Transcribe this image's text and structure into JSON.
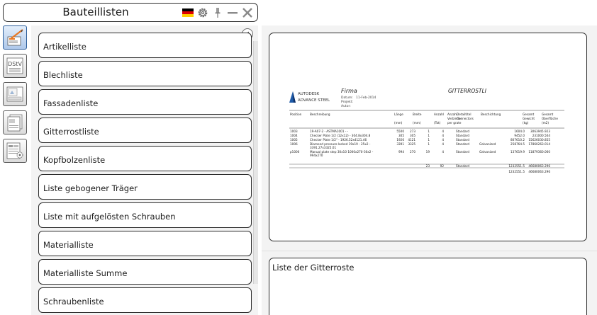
{
  "window": {
    "title": "Bauteillisten"
  },
  "toolbar": {
    "icons": [
      "german-flag-icon",
      "settings-gear-icon",
      "pin-icon",
      "minimize-icon",
      "close-icon"
    ]
  },
  "sidebar": {
    "buttons": [
      {
        "name": "report-lists-icon",
        "active": true
      },
      {
        "name": "dstv-icon",
        "label": "DStV",
        "active": false
      },
      {
        "name": "drawing-sheet-icon",
        "active": false
      },
      {
        "name": "document-stack-icon",
        "active": false
      },
      {
        "name": "table-settings-icon",
        "active": false
      }
    ]
  },
  "lists": {
    "items": [
      {
        "label": "Artikelliste"
      },
      {
        "label": "Blechliste"
      },
      {
        "label": "Fassadenliste"
      },
      {
        "label": "Gitterrostliste"
      },
      {
        "label": "Kopfbolzenliste"
      },
      {
        "label": "Liste gebogener Träger"
      },
      {
        "label": "Liste mit aufgelösten Schrauben"
      },
      {
        "label": "Materialliste"
      },
      {
        "label": "Materialliste Summe"
      },
      {
        "label": "Schraubenliste"
      }
    ]
  },
  "preview": {
    "logo_line1": "AUTODESK",
    "logo_line2": "ADVANCE STEEL",
    "company": "Firma",
    "meta": {
      "date_label": "Datum:",
      "date_value": "11-Feb-2014",
      "project_label": "Projekt:",
      "author_label": "Autor:"
    },
    "report_title": "GITTERROSTLI",
    "headers": [
      {
        "col": "position",
        "lines": [
          "Position"
        ]
      },
      {
        "col": "desc",
        "lines": [
          "Beschreibung"
        ]
      },
      {
        "col": "length",
        "lines": [
          "Länge",
          "",
          "(mm)"
        ]
      },
      {
        "col": "width",
        "lines": [
          "Breite",
          "",
          "(mm)"
        ]
      },
      {
        "col": "count",
        "lines": [
          "Anzahl",
          "",
          "(Tot)"
        ]
      },
      {
        "col": "connectors",
        "lines": [
          "Anzahl",
          "Verbinder",
          "per grate"
        ]
      },
      {
        "col": "conn-detail",
        "lines": [
          "Detailtitel",
          "Connectors"
        ]
      },
      {
        "col": "coating",
        "lines": [
          "Beschichtung"
        ]
      },
      {
        "col": "weight",
        "lines": [
          "Gesamt",
          "Gewicht",
          "(kg)"
        ]
      },
      {
        "col": "surface",
        "lines": [
          "Gesamt",
          "Oberfläche",
          "(m2)"
        ]
      }
    ],
    "rows": [
      {
        "position": "1003",
        "desc": "19-A07-2 - ASTMA1001 - -",
        "length": "5500",
        "width": "273",
        "count": "1",
        "connectors": "4",
        "conn_detail": "Standard",
        "coating": "",
        "weight": "1604.0",
        "surface": "3063945.923"
      },
      {
        "position": "1004",
        "desc": "Checker Plate 1/2 (12x12) - 304.8x304.8",
        "length": "305",
        "width": "305",
        "count": "1",
        "connectors": "4",
        "conn_detail": "Standard",
        "coating": "",
        "weight": "9452.0",
        "surface": "231000.504"
      },
      {
        "position": "1005",
        "desc": "Checker Plate 1/2\" - 1926.52x4121.46",
        "length": "1926",
        "width": "4121",
        "count": "1",
        "connectors": "4",
        "conn_detail": "Standard",
        "coating": "",
        "weight": "807610.2",
        "surface": "15626030.855"
      },
      {
        "position": "1006",
        "desc": "Diamond pressure-locked 19x19 - 25x2 - 3391.27x3325.01",
        "length": "3391",
        "width": "3325",
        "count": "1",
        "connectors": "4",
        "conn_detail": "Standard",
        "coating": "Galvanized",
        "weight": "258764.5",
        "surface": "17860263.014"
      },
      {
        "position": "p1000",
        "desc": "Manual plate step 30x10 1000x270-30x2 - 994x270",
        "length": "994",
        "width": "270",
        "count": "19",
        "connectors": "4",
        "conn_detail": "Standard",
        "coating": "Galvanized",
        "weight": "137619.9",
        "surface": "11879360.060"
      }
    ],
    "totals": {
      "count": "23",
      "connectors": "92",
      "conn_detail": "Standard",
      "weight": "1232551.5",
      "surface": "46680063.296"
    },
    "grand_total": {
      "weight": "1232551.5",
      "surface": "46680063.296"
    }
  },
  "description": {
    "text": "Liste der Gitterroste"
  }
}
